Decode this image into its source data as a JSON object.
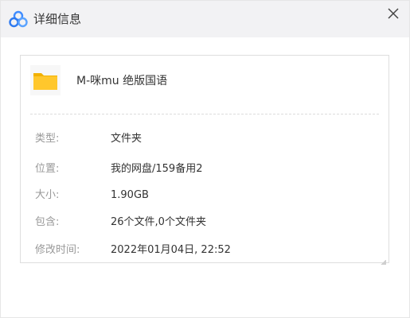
{
  "window": {
    "title": "详细信息"
  },
  "file": {
    "name": "M-咪mu 绝版国语",
    "icon": "folder-icon"
  },
  "details": [
    {
      "label": "类型:",
      "value": "文件夹"
    },
    {
      "label": "位置:",
      "value": "我的网盘/159备用2"
    },
    {
      "label": "大小:",
      "value": "1.90GB"
    },
    {
      "label": "包含:",
      "value": "26个文件,0个文件夹"
    },
    {
      "label": "修改时间:",
      "value": "2022年01月04日, 22:52"
    }
  ],
  "colors": {
    "folder": "#ffc72c",
    "folder_dark": "#f2b100",
    "app_icon": "#3f8cff"
  }
}
